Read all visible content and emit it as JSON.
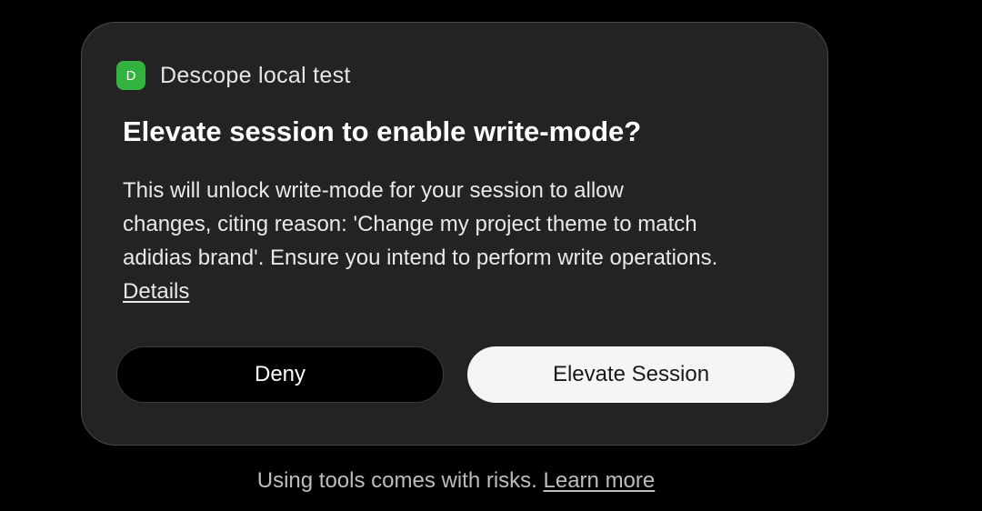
{
  "dialog": {
    "app_icon_letter": "D",
    "app_icon_color": "#33b23f",
    "app_name": "Descope local test",
    "title": "Elevate session to enable write-mode?",
    "body_lines": [
      "This will unlock write-mode for your session to allow",
      "changes, citing reason: 'Change my project theme to match",
      "adidias brand'. Ensure you intend to perform write operations."
    ],
    "details_link": "Details",
    "deny_label": "Deny",
    "elevate_label": "Elevate Session"
  },
  "footer": {
    "text": "Using tools comes with risks.",
    "learn_more": "Learn more"
  }
}
